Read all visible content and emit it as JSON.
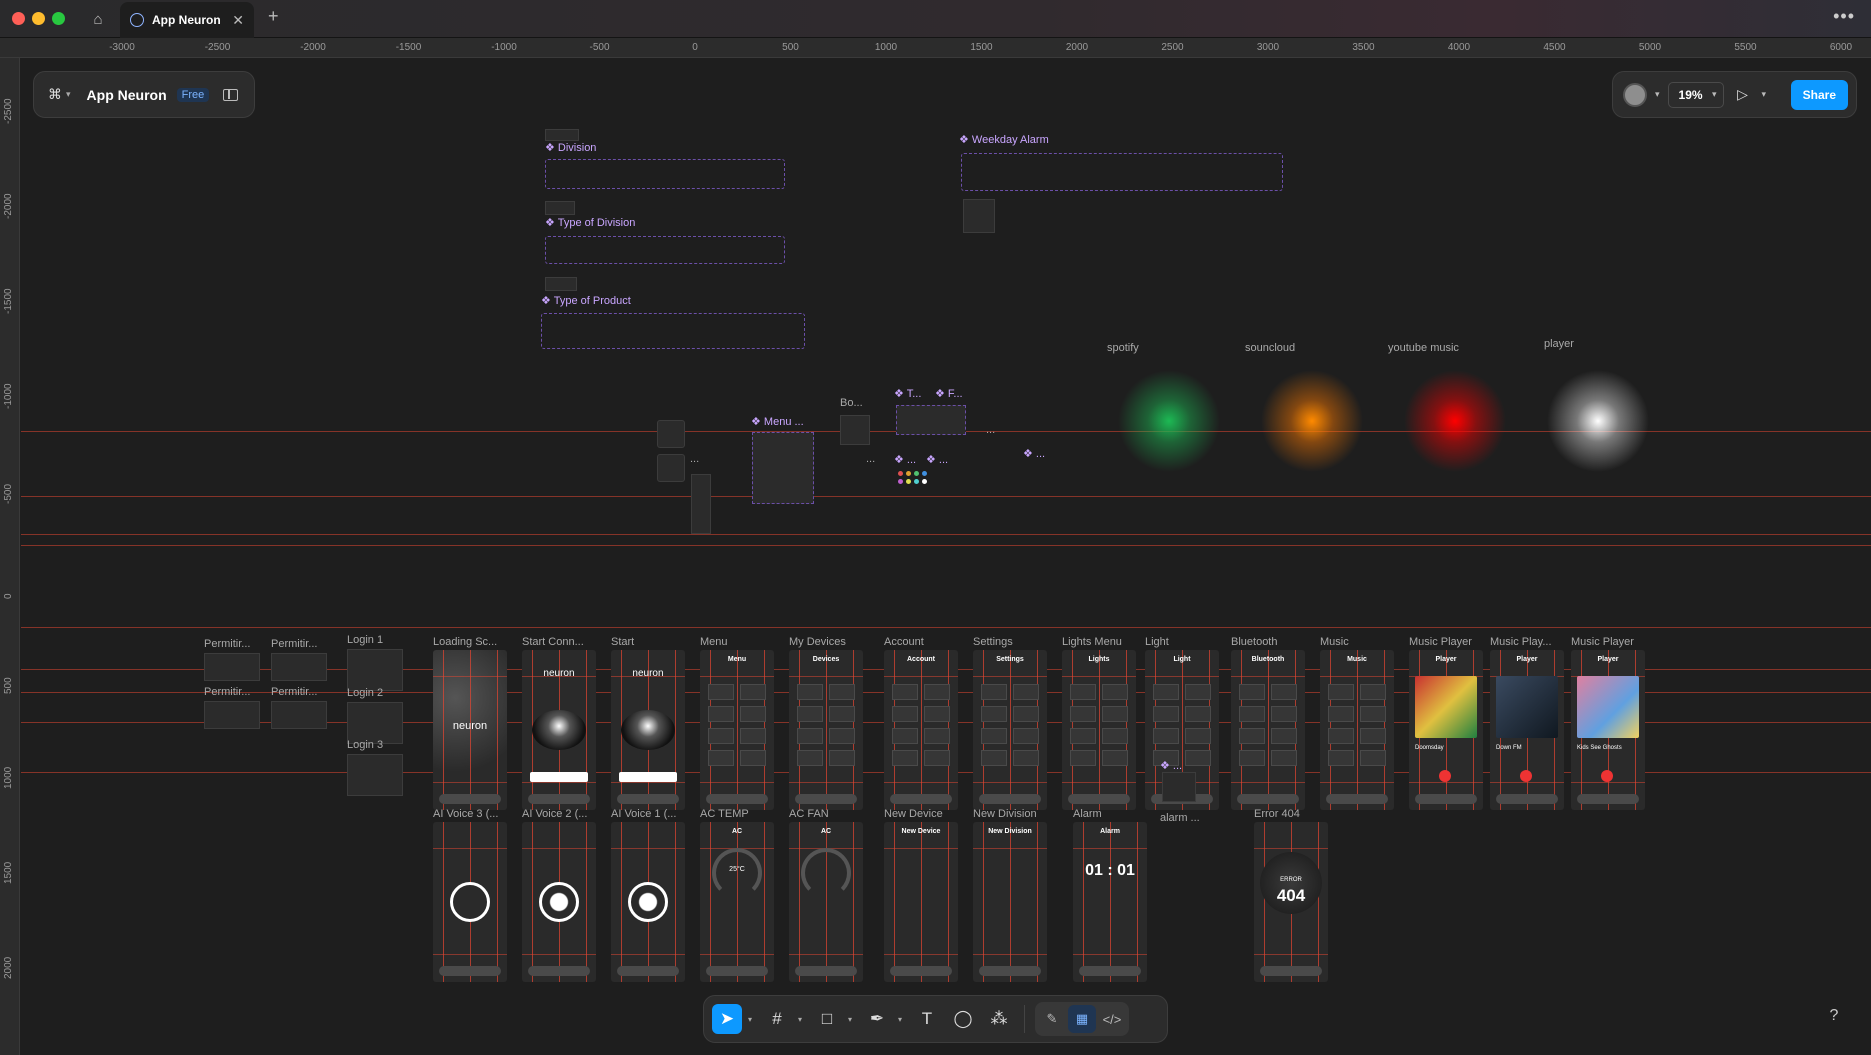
{
  "window": {
    "tab_title": "App Neuron",
    "home_icon": "home-icon",
    "new_tab_icon": "plus-icon",
    "more_icon": "ellipsis-icon"
  },
  "file": {
    "name": "App Neuron",
    "plan_badge": "Free"
  },
  "header_right": {
    "zoom_level": "19%",
    "share_label": "Share"
  },
  "ruler": {
    "top": [
      "-3000",
      "-2500",
      "-2000",
      "-1500",
      "-1000",
      "-500",
      "0",
      "500",
      "1000",
      "1500",
      "2000",
      "2500",
      "3000",
      "3500",
      "4000",
      "4500",
      "5000",
      "5500",
      "6000"
    ],
    "left": [
      "-2500",
      "-2000",
      "-1500",
      "-1000",
      "-500",
      "0",
      "500",
      "1000",
      "1500",
      "2000"
    ]
  },
  "components": {
    "division": "❖ Division",
    "type_division": "❖ Type of Division",
    "type_product": "❖ Type of Product",
    "weekday_alarm": "❖ Weekday Alarm",
    "menu": "❖ Menu ...",
    "t": "❖ T...",
    "f": "❖ F...",
    "dots1": "❖ ...",
    "dots2": "❖ ...",
    "dots3": "❖ ...",
    "dots4": "❖ ...",
    "bo": "Bo...",
    "ellipsis_a": "...",
    "ellipsis_b": "...",
    "ellipsis_c": "..."
  },
  "services": {
    "spotify": "spotify",
    "soundcloud": "souncloud",
    "youtube": "youtube music",
    "player": "player"
  },
  "colors": {
    "spotify": "#1db954",
    "soundcloud": "#ff7a00",
    "youtube": "#ff0000",
    "player": "#ffffff",
    "accent": "#0d99ff"
  },
  "frames_row1": [
    {
      "label": "Loading Sc...",
      "title": ""
    },
    {
      "label": "Start Conn...",
      "title": "neuron"
    },
    {
      "label": "Start",
      "title": "neuron"
    },
    {
      "label": "Menu",
      "title": "Menu"
    },
    {
      "label": "My Devices",
      "title": "Devices"
    },
    {
      "label": "Account",
      "title": "Account"
    },
    {
      "label": "Settings",
      "title": "Settings"
    },
    {
      "label": "Lights Menu",
      "title": "Lights"
    },
    {
      "label": "Light",
      "title": "Light"
    },
    {
      "label": "Bluetooth",
      "title": "Bluetooth"
    },
    {
      "label": "Music",
      "title": "Music"
    },
    {
      "label": "Music Player",
      "title": "Player"
    },
    {
      "label": "Music Play...",
      "title": "Player"
    },
    {
      "label": "Music Player",
      "title": "Player"
    }
  ],
  "frames_row2": [
    {
      "label": "AI Voice 3 (...",
      "title": ""
    },
    {
      "label": "AI Voice 2 (...",
      "title": ""
    },
    {
      "label": "AI Voice 1 (...",
      "title": ""
    },
    {
      "label": "AC TEMP",
      "title": "AC"
    },
    {
      "label": "AC FAN",
      "title": "AC"
    },
    {
      "label": "New Device",
      "title": "New Device"
    },
    {
      "label": "New Division",
      "title": "New Division"
    },
    {
      "label": "Alarm",
      "title": "Alarm"
    },
    {
      "label": "Error 404",
      "title": ""
    }
  ],
  "screen_text": {
    "loading_logo": "neuron",
    "alarm_time": "01 : 01",
    "error_word": "ERROR",
    "error_code": "404",
    "alarm_extra": "alarm ...",
    "ac_temp": "25°C",
    "song1": "Doomsday",
    "song2": "Down FM",
    "song3": "Kids See Ghosts"
  },
  "left_frames": {
    "permit1": "Permitir...",
    "permit2": "Permitir...",
    "permit3": "Permitir...",
    "permit4": "Permitir...",
    "login1": "Login 1",
    "login2": "Login 2",
    "login3": "Login 3"
  },
  "toolbar": {
    "tools": [
      "move-icon",
      "frame-icon",
      "rectangle-icon",
      "pen-icon",
      "text-icon",
      "comment-icon",
      "actions-icon"
    ],
    "modes": [
      "draw-mode-icon",
      "design-mode-icon",
      "dev-mode-icon"
    ]
  },
  "help_label": "?"
}
